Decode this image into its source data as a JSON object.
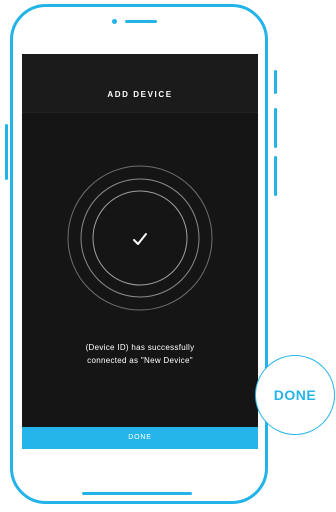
{
  "screen": {
    "title": "ADD DEVICE",
    "status_icon": "checkmark-icon",
    "message": "(Device ID) has successfully\nconnected as \"New Device\"",
    "done_label": "DONE"
  },
  "callout": {
    "label": "DONE"
  },
  "colors": {
    "accent": "#25b5ea",
    "screen_background": "#151515",
    "header_background": "#1b1b1b",
    "text": "#ffffff",
    "ring": "#8a8a8a"
  }
}
